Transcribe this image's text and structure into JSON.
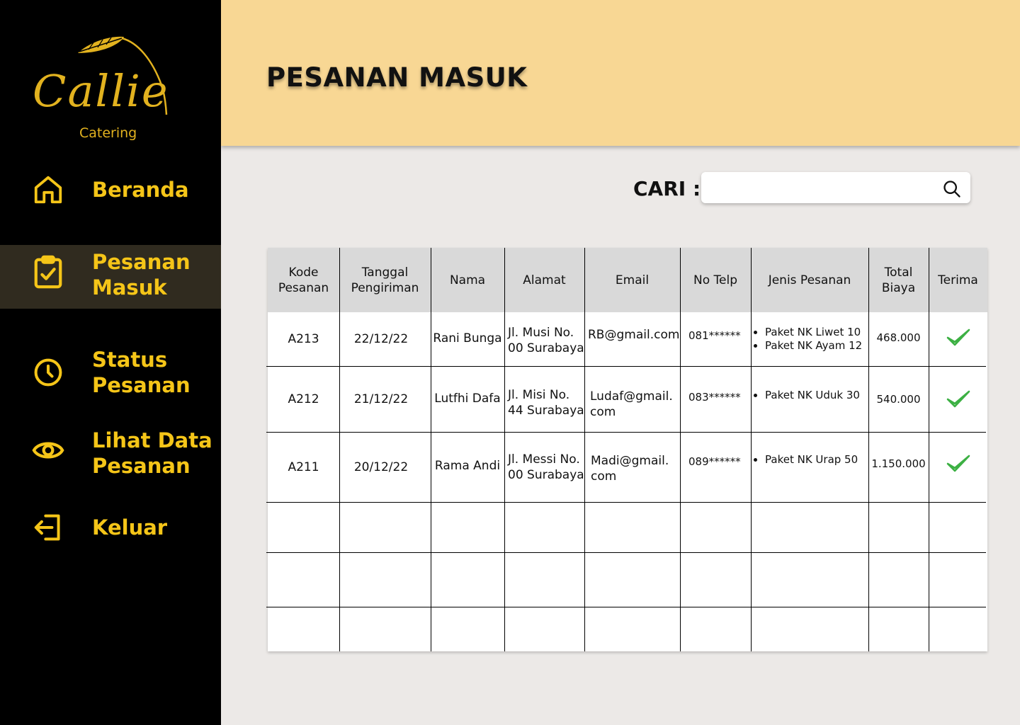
{
  "brand": {
    "name": "Callie",
    "tagline": "Catering",
    "color": "#e2b21f"
  },
  "sidebar": {
    "items": [
      {
        "label": "Beranda",
        "icon": "home-icon",
        "active": false
      },
      {
        "label": "Pesanan\nMasuk",
        "icon": "clipboard-check-icon",
        "active": true
      },
      {
        "label": "Status\nPesanan",
        "icon": "clock-icon",
        "active": false
      },
      {
        "label": "Lihat Data\nPesanan",
        "icon": "eye-icon",
        "active": false
      },
      {
        "label": "Keluar",
        "icon": "logout-icon",
        "active": false
      }
    ],
    "accent": "#f5c518"
  },
  "header": {
    "title": "PESANAN MASUK",
    "background": "#f8d794"
  },
  "search": {
    "label": "CARI :",
    "value": "",
    "placeholder": ""
  },
  "table": {
    "headers": [
      "Kode\nPesanan",
      "Tanggal\nPengiriman",
      "Nama",
      "Alamat",
      "Email",
      "No Telp",
      "Jenis Pesanan",
      "Total\nBiaya",
      "Terima"
    ],
    "rows": [
      {
        "kode": "A213",
        "tanggal": "22/12/22",
        "nama": "Rani Bunga",
        "alamat_1": "Jl. Musi No.",
        "alamat_2": "00 Surabaya",
        "email_1": "RB@gmail.com",
        "email_2": "",
        "telp": "081******",
        "jenis_1": "Paket NK Liwet 10",
        "jenis_2": "Paket NK Ayam 12",
        "total": "468.000"
      },
      {
        "kode": "A212",
        "tanggal": "21/12/22",
        "nama": "Lutfhi Dafa",
        "alamat_1": "Jl. Misi No.",
        "alamat_2": "44 Surabaya",
        "email_1": "Ludaf@gmail.",
        "email_2": "com",
        "telp": "083******",
        "jenis_1": "Paket NK Uduk 30",
        "jenis_2": "",
        "total": "540.000"
      },
      {
        "kode": "A211",
        "tanggal": "20/12/22",
        "nama": "Rama Andi",
        "alamat_1": "Jl. Messi No.",
        "alamat_2": "00 Surabaya",
        "email_1": "Madi@gmail.",
        "email_2": "com",
        "telp": "089******",
        "jenis_1": "Paket NK Urap 50",
        "jenis_2": "",
        "total": "1.150.000"
      }
    ],
    "check_color": "#3cb043"
  }
}
